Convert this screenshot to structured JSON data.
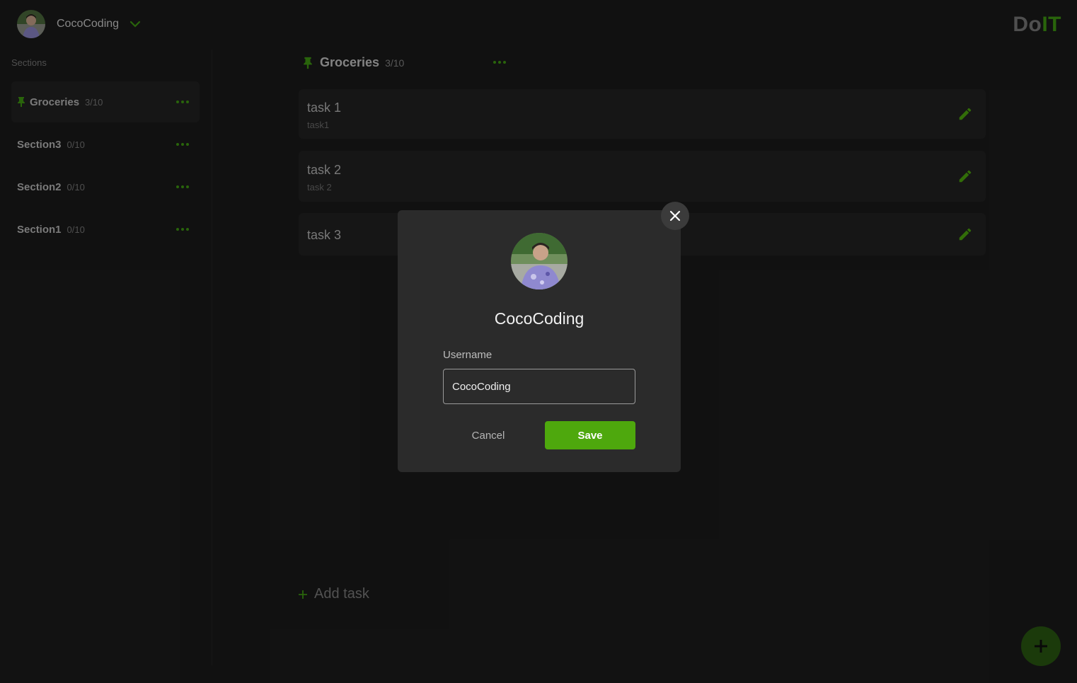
{
  "colors": {
    "accent": "#4ea80d",
    "accent_dark": "#2a5a12",
    "background": "#1b1b1b",
    "card": "#222222",
    "modal": "#2b2b2b"
  },
  "header": {
    "user_name": "CocoCoding",
    "avatar_icon": "user-avatar",
    "dropdown_icon": "chevron-down-icon",
    "brand_do": "Do",
    "brand_it": "IT"
  },
  "sidebar": {
    "label": "Sections",
    "items": [
      {
        "name": "Groceries",
        "count": "3/10",
        "pinned": true,
        "active": true
      },
      {
        "name": "Section3",
        "count": "0/10",
        "pinned": false,
        "active": false
      },
      {
        "name": "Section2",
        "count": "0/10",
        "pinned": false,
        "active": false
      },
      {
        "name": "Section1",
        "count": "0/10",
        "pinned": false,
        "active": false
      }
    ]
  },
  "main": {
    "title": "Groceries",
    "count": "3/10",
    "tasks": [
      {
        "title": "task 1",
        "subtitle": "task1"
      },
      {
        "title": "task 2",
        "subtitle": "task 2"
      },
      {
        "title": "task 3",
        "subtitle": ""
      }
    ],
    "add_task_label": "Add task",
    "fab_icon": "plus-icon"
  },
  "modal": {
    "name": "CocoCoding",
    "username_label": "Username",
    "username_value": "CocoCoding",
    "cancel_label": "Cancel",
    "save_label": "Save",
    "close_icon": "close-icon"
  }
}
